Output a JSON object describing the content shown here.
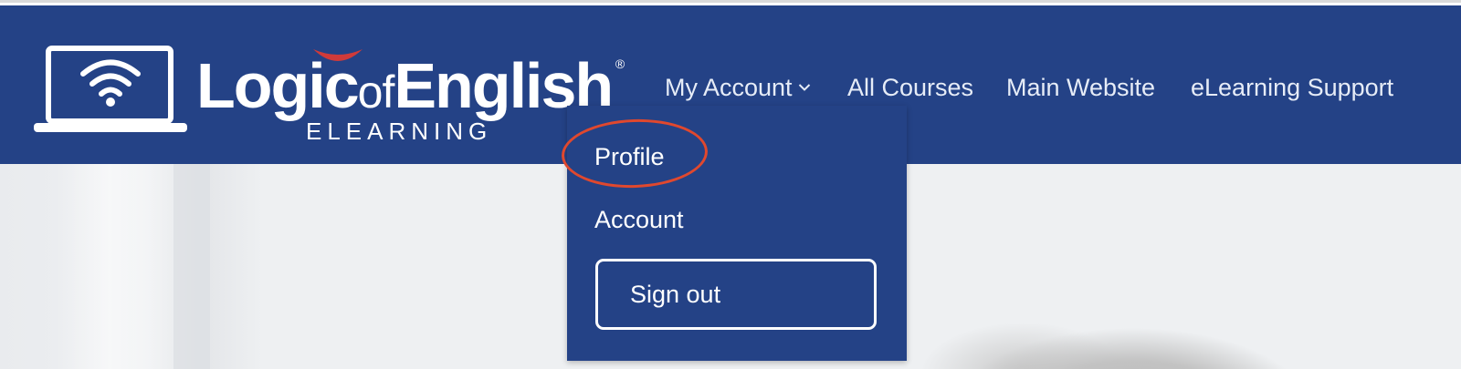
{
  "brand": {
    "logo_word1": "Logic",
    "logo_word2": "of",
    "logo_word3": "English",
    "logo_reg": "®",
    "logo_sub": "ELEARNING",
    "primary_color": "#244286",
    "accent_color": "#d03a3a"
  },
  "nav": {
    "items": [
      {
        "label": "My Account",
        "has_dropdown": true,
        "icon": "chevron-down-icon"
      },
      {
        "label": "All Courses"
      },
      {
        "label": "Main Website"
      },
      {
        "label": "eLearning Support"
      }
    ]
  },
  "dropdown": {
    "items": [
      {
        "label": "Profile"
      },
      {
        "label": "Account"
      }
    ],
    "signout_label": "Sign out"
  },
  "annotation": {
    "highlight_color": "#e0482e"
  }
}
